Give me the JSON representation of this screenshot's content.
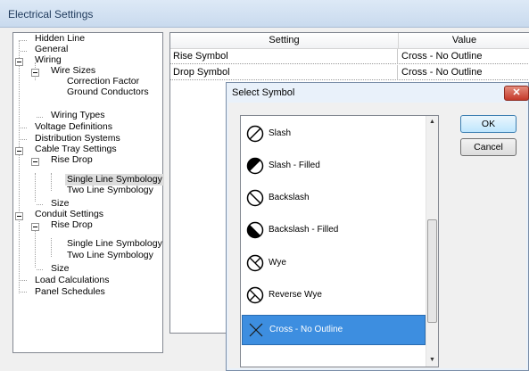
{
  "window": {
    "title": "Electrical Settings"
  },
  "tree": {
    "items": [
      "Hidden Line",
      "General",
      "Wiring",
      "Wire Sizes",
      "Correction Factor",
      "Ground Conductors",
      "Wiring Types",
      "Voltage Definitions",
      "Distribution Systems",
      "Cable Tray Settings",
      "Rise Drop",
      "Single Line Symbology",
      "Two Line Symbology",
      "Size",
      "Conduit Settings",
      "Rise Drop",
      "Single Line Symbology",
      "Two Line Symbology",
      "Size",
      "Load Calculations",
      "Panel Schedules"
    ],
    "selected": "Single Line Symbology"
  },
  "grid": {
    "headers": [
      "Setting",
      "Value"
    ],
    "rows": [
      {
        "setting": "Rise Symbol",
        "value": "Cross - No Outline"
      },
      {
        "setting": "Drop Symbol",
        "value": "Cross - No Outline"
      }
    ]
  },
  "dialog": {
    "title": "Select Symbol",
    "close": "✕",
    "ok_label": "OK",
    "cancel_label": "Cancel",
    "symbols": [
      {
        "label": "Slash",
        "icon": "slash-symbol-icon"
      },
      {
        "label": "Slash - Filled",
        "icon": "slash-filled-symbol-icon"
      },
      {
        "label": "Backslash",
        "icon": "backslash-symbol-icon"
      },
      {
        "label": "Backslash - Filled",
        "icon": "backslash-filled-symbol-icon"
      },
      {
        "label": "Wye",
        "icon": "wye-symbol-icon"
      },
      {
        "label": "Reverse Wye",
        "icon": "reverse-wye-symbol-icon"
      },
      {
        "label": "Cross - No Outline",
        "icon": "cross-no-outline-symbol-icon"
      }
    ],
    "selected_symbol": "Cross - No Outline"
  }
}
